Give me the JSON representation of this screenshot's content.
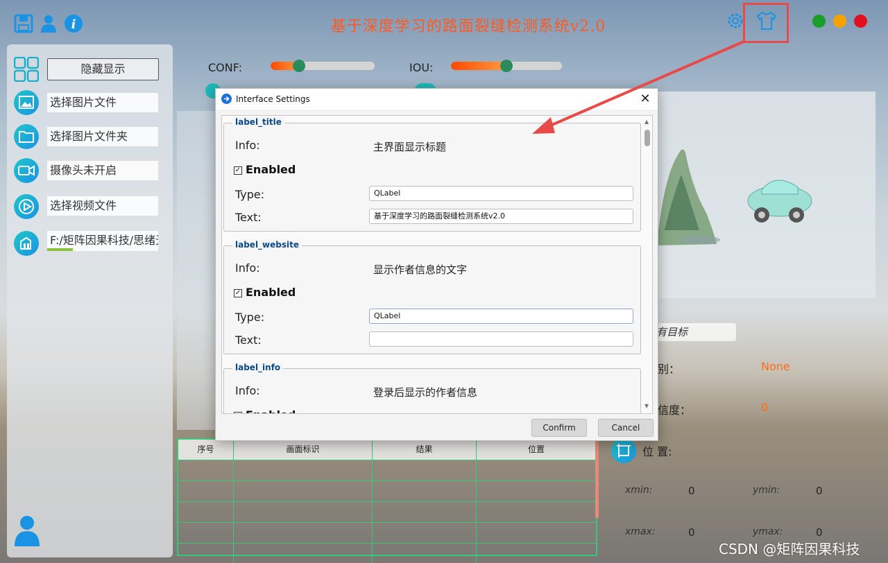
{
  "app": {
    "title": "基于深度学习的路面裂缝检测系统v2.0",
    "window_dots": [
      "#1a9e2a",
      "#f5a300",
      "#e01020"
    ]
  },
  "sidebar": {
    "hide_button": "隐藏显示",
    "items": [
      {
        "label": "选择图片文件",
        "icon": "image-icon"
      },
      {
        "label": "选择图片文件夹",
        "icon": "folder-icon"
      },
      {
        "label": "摄像头未开启",
        "icon": "camera-icon"
      },
      {
        "label": "选择视频文件",
        "icon": "play-icon"
      },
      {
        "label": "F:/矩阵因果科技/思绪无",
        "icon": "model-icon"
      }
    ]
  },
  "sliders": {
    "conf_label": "CONF:",
    "conf_value": 0.27,
    "iou_label": "IOU:",
    "iou_value": 0.5
  },
  "table": {
    "headers": [
      "序号",
      "画面标识",
      "结果",
      "位置"
    ],
    "rows": 5
  },
  "results": {
    "target_select": "有目标",
    "class_label_suffix": "别：",
    "class_value": "None",
    "conf_label_suffix": "信度：",
    "conf_value": "0",
    "position_label": "位 置:",
    "xmin_label": "xmin:",
    "xmin": "0",
    "ymin_label": "ymin:",
    "ymin": "0",
    "xmax_label": "xmax:",
    "xmax": "0",
    "ymax_label": "ymax:",
    "ymax": "0"
  },
  "watermark": "CSDN @矩阵因果科技",
  "dialog": {
    "title": "Interface Settings",
    "groups": [
      {
        "name": "label_title",
        "info_label": "Info:",
        "info": "主界面显示标题",
        "enabled_label": "Enabled",
        "type_label": "Type:",
        "type": "QLabel",
        "text_label": "Text:",
        "text": "基于深度学习的路面裂缝检测系统v2.0"
      },
      {
        "name": "label_website",
        "info_label": "Info:",
        "info": "显示作者信息的文字",
        "enabled_label": "Enabled",
        "type_label": "Type:",
        "type": "QLabel",
        "text_label": "Text:",
        "text": ""
      },
      {
        "name": "label_info",
        "info_label": "Info:",
        "info": "登录后显示的作者信息",
        "enabled_label": "Enabled"
      }
    ],
    "confirm": "Confirm",
    "cancel": "Cancel"
  }
}
